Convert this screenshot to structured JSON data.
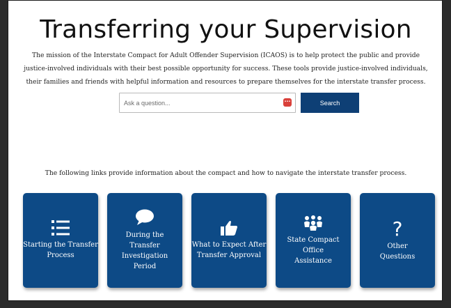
{
  "page": {
    "title": "Transferring your Supervision",
    "mission": "The mission of the Interstate Compact for Adult Offender Supervision (ICAOS) is to help protect the public and provide justice-involved individuals with their best possible opportunity for success. These tools provide justice-involved individuals, their families and friends with helpful information and resources to prepare themselves for the interstate transfer process."
  },
  "search": {
    "placeholder": "Ask a question...",
    "value": "",
    "button_label": "Search"
  },
  "links": {
    "intro": "The following links provide information about the compact and how to navigate the interstate transfer process.",
    "cards": [
      {
        "label": "Starting the Transfer\nProcess",
        "icon": "list-icon"
      },
      {
        "label": "During the\nTransfer\nInvestigation\nPeriod",
        "icon": "speech-bubble-icon"
      },
      {
        "label": "What to Expect After\nTransfer Approval",
        "icon": "thumbs-up-icon"
      },
      {
        "label": "State Compact Office\nAssistance",
        "icon": "people-group-icon"
      },
      {
        "label": "Other\nQuestions",
        "icon": "question-mark-icon",
        "glyph": "?"
      }
    ]
  },
  "colors": {
    "card_background": "#0d4a86",
    "search_button": "#0e3f75",
    "ellipsis_badge": "#d9403a"
  }
}
